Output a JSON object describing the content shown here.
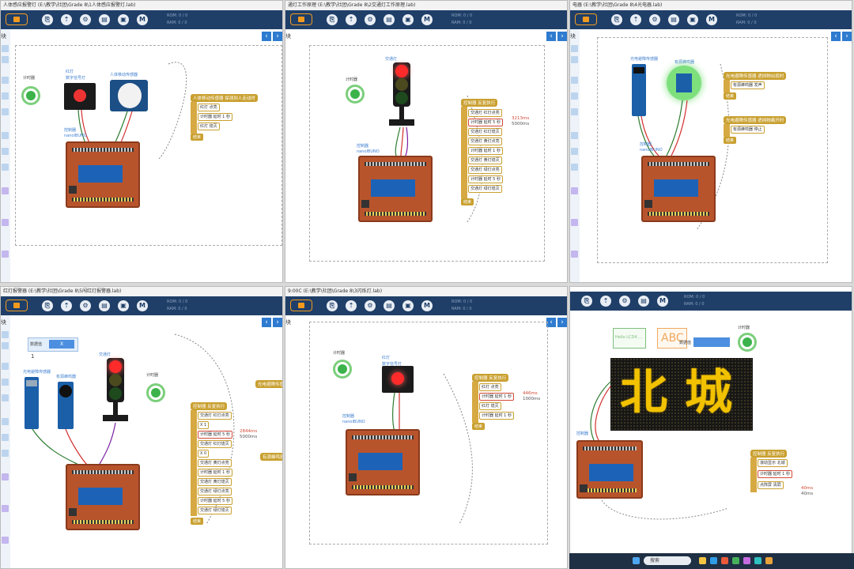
{
  "panels": [
    {
      "title": "人体感应报警灯 (E:\\教学\\社团\\Grade 8\\1人体感应报警灯.lab)",
      "block_menu": "块",
      "ram": "ROM: 0 / 0",
      "ram2": "RAM: 0 / 0",
      "labels": {
        "clock": "计时器",
        "led": "红灯",
        "led_sub": "数字信号灯",
        "pir": "人体移动传感器",
        "board": "控制器",
        "board_sub": "nanoIBUNO"
      },
      "hat": "人体移动传感器 探测到人走动时",
      "cmds": [
        "红灯 点亮",
        "计时器 延时 1 秒",
        "红灯 熄灭"
      ],
      "end": "结束"
    },
    {
      "title": "通灯工作原理 (E:\\教学\\社团\\Grade 8\\2交通灯工作原理.lab)",
      "block_menu": "块",
      "ram": "ROM: 0 / 0",
      "ram2": "RAM: 0 / 0",
      "labels": {
        "clock": "计时器",
        "tl": "交通灯",
        "board": "控制器",
        "board_sub": "nanoIBUNO"
      },
      "hat": "控制器 反复执行",
      "cmds": [
        "交通灯 红灯点亮",
        "计时器 延时 5 秒",
        "交通灯 红灯熄灭",
        "交通灯 黄灯点亮",
        "计时器 延时 1 秒",
        "交通灯 黄灯熄灭",
        "交通灯 绿灯点亮",
        "计时器 延时 5 秒",
        "交通灯 绿灯熄灭"
      ],
      "note": "3213ms",
      "note2": "5000ms",
      "end": "结束"
    },
    {
      "title": "电器 (E:\\教学\\社团\\Grade 8\\4光电器.lab)",
      "block_menu": "块",
      "ram": "ROM: 0 / 0",
      "ram2": "RAM: 0 / 0",
      "labels": {
        "sensor": "光电避障传感器",
        "buzzer": "有源蜂鸣器",
        "board": "控制器",
        "board_sub": "nanoIBUNO"
      },
      "hat1": "光电避障传感器 遮挡物出现时",
      "cmd1": "有源蜂鸣器 发声",
      "hat2": "光电避障传感器 遮挡物离开时",
      "cmd2": "有源蜂鸣器 停止",
      "end": "结束"
    },
    {
      "title": "红灯报警器 (E:\\教学\\社团\\Grade 8\\5闯红灯报警器.lab)",
      "block_menu": "块",
      "ram": "ROM: 0 / 0",
      "ram2": "RAM: 0 / 0",
      "labels": {
        "var": "数据值",
        "var_val": "X",
        "one": "1",
        "sensor": "光电避障传感器",
        "buzzer": "有源蜂鸣器",
        "tl": "交通灯",
        "clock": "计时器"
      },
      "hat": "控制器 反复执行",
      "cmds": [
        "交通灯 红灯点亮",
        "X 1",
        "计时器 延时 5 秒",
        "交通灯 红灯熄灭",
        "X 0",
        "交通灯 黄灯点亮",
        "计时器 延时 1 秒",
        "交通灯 黄灯熄灭",
        "交通灯 绿灯点亮",
        "计时器 延时 5 秒",
        "交通灯 绿灯熄灭"
      ],
      "note": "2844ms",
      "note2": "5000ms",
      "side1": "光电避障传感器",
      "side2": "有源蜂鸣器",
      "end": "结束"
    },
    {
      "title": "9:00C (E:\\教学\\社团\\Grade 8\\3闪烁灯.lab)",
      "block_menu": "块",
      "ram": "ROM: 0 / 0",
      "ram2": "RAM: 0 / 0",
      "labels": {
        "clock": "计时器",
        "led": "红灯",
        "led_sub": "数字信号灯",
        "board": "控制器",
        "board_sub": "nanoIBUNO"
      },
      "hat": "控制器 反复执行",
      "cmds": [
        "红灯 点亮",
        "计时器 延时 1 秒",
        "红灯 熄灭",
        "计时器 延时 1 秒"
      ],
      "note": "446ms",
      "note2": "1000ms",
      "end": "结束"
    },
    {
      "title": "",
      "ram": "ROM: 0 / 0",
      "ram2": "RAM: 0 / 0",
      "labels": {
        "input": "Hello LCD4 ...",
        "abc": "ABC",
        "var": "数据值",
        "clock": "计时器",
        "chars": "北城",
        "board": "控制器"
      },
      "cmds": [
        "控制器 反复执行",
        "滚动显示 北城",
        "计时器 延时 1 秒",
        "点阵屏 清屏"
      ],
      "note": "40ms",
      "note2": "40ms",
      "search": "搜索"
    }
  ]
}
